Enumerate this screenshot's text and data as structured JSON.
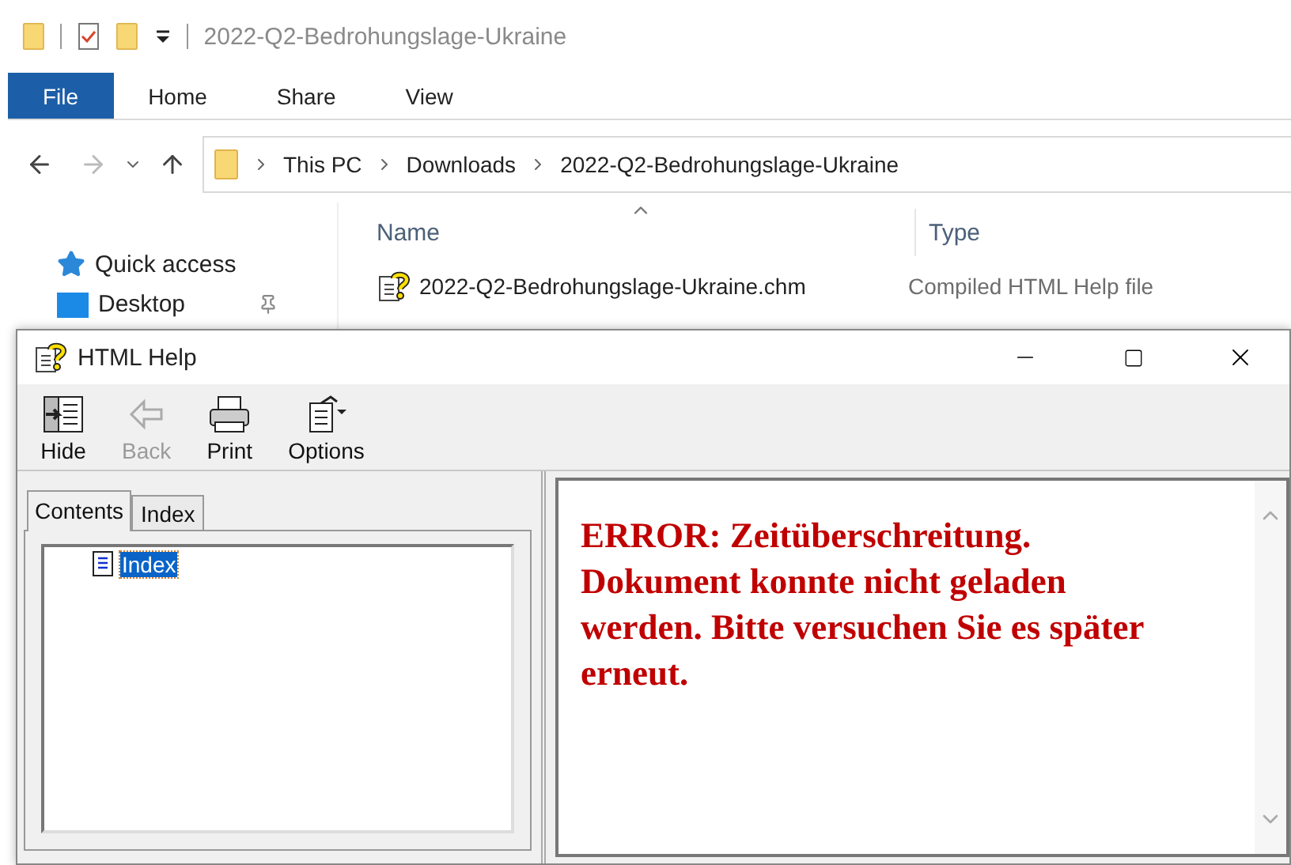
{
  "explorer": {
    "title": "2022-Q2-Bedrohungslage-Ukraine",
    "ribbon_tabs": [
      {
        "label": "File",
        "selected": true
      },
      {
        "label": "Home",
        "selected": false
      },
      {
        "label": "Share",
        "selected": false
      },
      {
        "label": "View",
        "selected": false
      }
    ],
    "breadcrumb": [
      "This PC",
      "Downloads",
      "2022-Q2-Bedrohungslage-Ukraine"
    ],
    "navigation": [
      {
        "label": "Quick access",
        "kind": "star",
        "pinned": false
      },
      {
        "label": "Desktop",
        "kind": "desktop",
        "pinned": true
      }
    ],
    "columns": [
      "Name",
      "Type"
    ],
    "files": [
      {
        "name": "2022-Q2-Bedrohungslage-Ukraine.chm",
        "type": "Compiled HTML Help file"
      }
    ]
  },
  "help_window": {
    "title": "HTML Help",
    "toolbar": [
      {
        "label": "Hide",
        "kind": "hide",
        "disabled": false
      },
      {
        "label": "Back",
        "kind": "back",
        "disabled": true
      },
      {
        "label": "Print",
        "kind": "print",
        "disabled": false
      },
      {
        "label": "Options",
        "kind": "options",
        "disabled": false
      }
    ],
    "tabs": [
      {
        "label": "Contents",
        "selected": true
      },
      {
        "label": "Index",
        "selected": false
      }
    ],
    "tree": [
      {
        "label": "Index",
        "selected": true
      }
    ],
    "message": "ERROR: Zeitüberschreitung. Dokument konnte nicht geladen werden. Bitte versuchen Sie es später erneut."
  }
}
